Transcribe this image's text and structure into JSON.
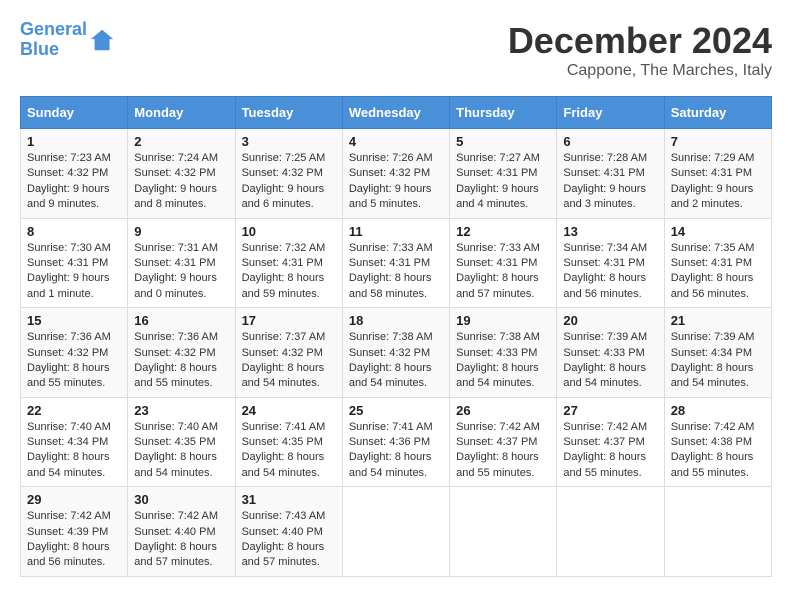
{
  "header": {
    "logo_line1": "General",
    "logo_line2": "Blue",
    "month": "December 2024",
    "location": "Cappone, The Marches, Italy"
  },
  "days_of_week": [
    "Sunday",
    "Monday",
    "Tuesday",
    "Wednesday",
    "Thursday",
    "Friday",
    "Saturday"
  ],
  "weeks": [
    [
      {
        "day": "1",
        "lines": [
          "Sunrise: 7:23 AM",
          "Sunset: 4:32 PM",
          "Daylight: 9 hours",
          "and 9 minutes."
        ]
      },
      {
        "day": "2",
        "lines": [
          "Sunrise: 7:24 AM",
          "Sunset: 4:32 PM",
          "Daylight: 9 hours",
          "and 8 minutes."
        ]
      },
      {
        "day": "3",
        "lines": [
          "Sunrise: 7:25 AM",
          "Sunset: 4:32 PM",
          "Daylight: 9 hours",
          "and 6 minutes."
        ]
      },
      {
        "day": "4",
        "lines": [
          "Sunrise: 7:26 AM",
          "Sunset: 4:32 PM",
          "Daylight: 9 hours",
          "and 5 minutes."
        ]
      },
      {
        "day": "5",
        "lines": [
          "Sunrise: 7:27 AM",
          "Sunset: 4:31 PM",
          "Daylight: 9 hours",
          "and 4 minutes."
        ]
      },
      {
        "day": "6",
        "lines": [
          "Sunrise: 7:28 AM",
          "Sunset: 4:31 PM",
          "Daylight: 9 hours",
          "and 3 minutes."
        ]
      },
      {
        "day": "7",
        "lines": [
          "Sunrise: 7:29 AM",
          "Sunset: 4:31 PM",
          "Daylight: 9 hours",
          "and 2 minutes."
        ]
      }
    ],
    [
      {
        "day": "8",
        "lines": [
          "Sunrise: 7:30 AM",
          "Sunset: 4:31 PM",
          "Daylight: 9 hours",
          "and 1 minute."
        ]
      },
      {
        "day": "9",
        "lines": [
          "Sunrise: 7:31 AM",
          "Sunset: 4:31 PM",
          "Daylight: 9 hours",
          "and 0 minutes."
        ]
      },
      {
        "day": "10",
        "lines": [
          "Sunrise: 7:32 AM",
          "Sunset: 4:31 PM",
          "Daylight: 8 hours",
          "and 59 minutes."
        ]
      },
      {
        "day": "11",
        "lines": [
          "Sunrise: 7:33 AM",
          "Sunset: 4:31 PM",
          "Daylight: 8 hours",
          "and 58 minutes."
        ]
      },
      {
        "day": "12",
        "lines": [
          "Sunrise: 7:33 AM",
          "Sunset: 4:31 PM",
          "Daylight: 8 hours",
          "and 57 minutes."
        ]
      },
      {
        "day": "13",
        "lines": [
          "Sunrise: 7:34 AM",
          "Sunset: 4:31 PM",
          "Daylight: 8 hours",
          "and 56 minutes."
        ]
      },
      {
        "day": "14",
        "lines": [
          "Sunrise: 7:35 AM",
          "Sunset: 4:31 PM",
          "Daylight: 8 hours",
          "and 56 minutes."
        ]
      }
    ],
    [
      {
        "day": "15",
        "lines": [
          "Sunrise: 7:36 AM",
          "Sunset: 4:32 PM",
          "Daylight: 8 hours",
          "and 55 minutes."
        ]
      },
      {
        "day": "16",
        "lines": [
          "Sunrise: 7:36 AM",
          "Sunset: 4:32 PM",
          "Daylight: 8 hours",
          "and 55 minutes."
        ]
      },
      {
        "day": "17",
        "lines": [
          "Sunrise: 7:37 AM",
          "Sunset: 4:32 PM",
          "Daylight: 8 hours",
          "and 54 minutes."
        ]
      },
      {
        "day": "18",
        "lines": [
          "Sunrise: 7:38 AM",
          "Sunset: 4:32 PM",
          "Daylight: 8 hours",
          "and 54 minutes."
        ]
      },
      {
        "day": "19",
        "lines": [
          "Sunrise: 7:38 AM",
          "Sunset: 4:33 PM",
          "Daylight: 8 hours",
          "and 54 minutes."
        ]
      },
      {
        "day": "20",
        "lines": [
          "Sunrise: 7:39 AM",
          "Sunset: 4:33 PM",
          "Daylight: 8 hours",
          "and 54 minutes."
        ]
      },
      {
        "day": "21",
        "lines": [
          "Sunrise: 7:39 AM",
          "Sunset: 4:34 PM",
          "Daylight: 8 hours",
          "and 54 minutes."
        ]
      }
    ],
    [
      {
        "day": "22",
        "lines": [
          "Sunrise: 7:40 AM",
          "Sunset: 4:34 PM",
          "Daylight: 8 hours",
          "and 54 minutes."
        ]
      },
      {
        "day": "23",
        "lines": [
          "Sunrise: 7:40 AM",
          "Sunset: 4:35 PM",
          "Daylight: 8 hours",
          "and 54 minutes."
        ]
      },
      {
        "day": "24",
        "lines": [
          "Sunrise: 7:41 AM",
          "Sunset: 4:35 PM",
          "Daylight: 8 hours",
          "and 54 minutes."
        ]
      },
      {
        "day": "25",
        "lines": [
          "Sunrise: 7:41 AM",
          "Sunset: 4:36 PM",
          "Daylight: 8 hours",
          "and 54 minutes."
        ]
      },
      {
        "day": "26",
        "lines": [
          "Sunrise: 7:42 AM",
          "Sunset: 4:37 PM",
          "Daylight: 8 hours",
          "and 55 minutes."
        ]
      },
      {
        "day": "27",
        "lines": [
          "Sunrise: 7:42 AM",
          "Sunset: 4:37 PM",
          "Daylight: 8 hours",
          "and 55 minutes."
        ]
      },
      {
        "day": "28",
        "lines": [
          "Sunrise: 7:42 AM",
          "Sunset: 4:38 PM",
          "Daylight: 8 hours",
          "and 55 minutes."
        ]
      }
    ],
    [
      {
        "day": "29",
        "lines": [
          "Sunrise: 7:42 AM",
          "Sunset: 4:39 PM",
          "Daylight: 8 hours",
          "and 56 minutes."
        ]
      },
      {
        "day": "30",
        "lines": [
          "Sunrise: 7:42 AM",
          "Sunset: 4:40 PM",
          "Daylight: 8 hours",
          "and 57 minutes."
        ]
      },
      {
        "day": "31",
        "lines": [
          "Sunrise: 7:43 AM",
          "Sunset: 4:40 PM",
          "Daylight: 8 hours",
          "and 57 minutes."
        ]
      },
      null,
      null,
      null,
      null
    ]
  ]
}
